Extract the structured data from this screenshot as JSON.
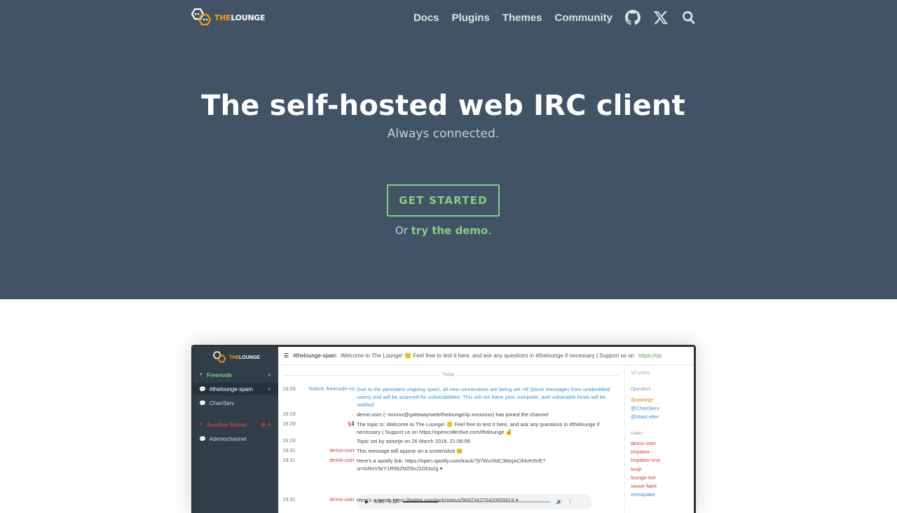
{
  "nav": {
    "logo_prefix": "THE",
    "logo_suffix": "LOUNGE",
    "links": [
      "Docs",
      "Plugins",
      "Themes",
      "Community"
    ],
    "icons": [
      "github-icon",
      "x-icon",
      "search-icon"
    ]
  },
  "hero": {
    "title": "The self-hosted web IRC client",
    "subtitle": "Always connected.",
    "cta": "GET STARTED",
    "demo_prefix": "Or ",
    "demo_link": "try the demo",
    "demo_suffix": "."
  },
  "colors": {
    "hero_bg": "#415364",
    "accent": "#84ce88",
    "logo_orange": "#f39c12"
  },
  "shot": {
    "logo_prefix": "THE",
    "logo_suffix": "LOUNGE",
    "networks": [
      {
        "name": "Freenode",
        "color": "#84ce88",
        "channels": [
          "#thelounge-spam",
          "ChanServ"
        ]
      },
      {
        "name": "Another Netwo",
        "color": "#d23b3b",
        "channels": [
          "#demochannel"
        ]
      }
    ],
    "topbar": {
      "channel": "#thelounge-spam",
      "topic": "Welcome to The Lounge! 🙂 Feel free to test it here, and ask any questions in #thelounge if necessary | Support us on",
      "link": "https://op"
    },
    "divider": "Today",
    "messages": [
      {
        "time": "19:28",
        "from": "Notice: freenode-co",
        "text": "Due to the persistent ongoing spam, all new connections are being set +R (block messages from unidentified users) and will be scanned for vulnerabilities. This will not harm your computer, and vulnerable hosts will be notified."
      },
      {
        "time": "19:28",
        "from": "→",
        "text": "demo-user (~xxxxxx@gateway/web/thelounge/ip.xxxxxxxx) has joined the channel"
      },
      {
        "time": "19:28",
        "from": "📢",
        "text": "The topic is: Welcome to The Lounge! 🙂 Feel free to test it here, and ask any questions in #thelounge if necessary | Support us on https://opencollective.com/thelounge 💰"
      },
      {
        "time": "19:28",
        "from": "",
        "text": "Topic set by astorije on 26 March 2018, 21:08:08"
      },
      {
        "time": "19:31",
        "from": "demo-user",
        "text": "This message will appear on a screenshot 😊"
      },
      {
        "time": "19:31",
        "from": "demo-user",
        "text": "Here's a spotify link: https://open.spotify.com/track/7jt7WxXMC3MzjAClhkrK9VE?si=GRoV9zY1R56ZMZ6oJ1ODo2g ▾"
      },
      {
        "time": "19:31",
        "from": "demo-user",
        "text": "Here's a tweet: https://twitter.com/jack/status/969234275420655616 ▾"
      }
    ],
    "audio_time": "0:00 / 0:30",
    "users_search": "10 users",
    "operators_label": "Operators",
    "operators": [
      "@astorije",
      "@ChanServ",
      "@MaxLeiter"
    ],
    "users_label": "Users",
    "users": [
      "demo-user",
      "Impaloo",
      "Impaloo-Vue",
      "lonjil",
      "lounge-bot",
      "savoir-faire",
      "zeroquake"
    ]
  }
}
